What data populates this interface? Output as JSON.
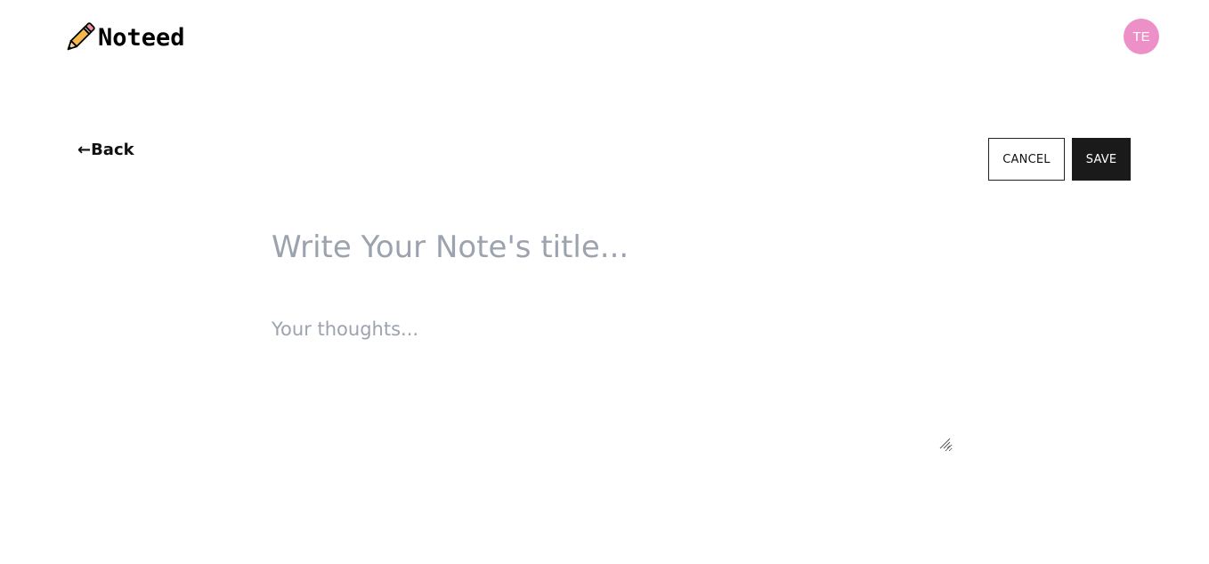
{
  "header": {
    "logo_text": "Noteed",
    "logo_icon": "pencil-icon",
    "avatar_initials": "TE",
    "avatar_color": "#ee90c8"
  },
  "nav": {
    "back_label": "←Back"
  },
  "actions": {
    "cancel_label": "CANCEL",
    "save_label": "SAVE"
  },
  "editor": {
    "title_value": "",
    "title_placeholder": "Write Your Note's title...",
    "body_value": "",
    "body_placeholder": "Your thoughts..."
  },
  "colors": {
    "save_bg": "#1a1a1a",
    "placeholder": "#9ca3af"
  }
}
